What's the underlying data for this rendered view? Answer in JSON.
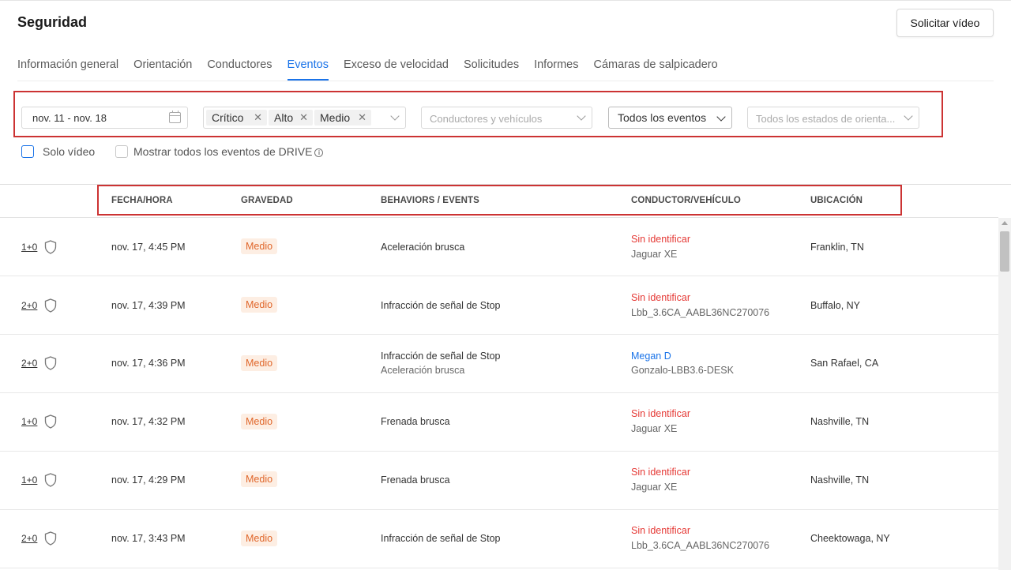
{
  "page": {
    "title": "Seguridad",
    "request_button": "Solicitar vídeo"
  },
  "tabs": [
    {
      "label": "Información general",
      "active": false
    },
    {
      "label": "Orientación",
      "active": false
    },
    {
      "label": "Conductores",
      "active": false
    },
    {
      "label": "Eventos",
      "active": true
    },
    {
      "label": "Exceso de velocidad",
      "active": false
    },
    {
      "label": "Solicitudes",
      "active": false
    },
    {
      "label": "Informes",
      "active": false
    },
    {
      "label": "Cámaras de salpicadero",
      "active": false
    }
  ],
  "filters": {
    "date_range": "nov. 11 - nov. 18",
    "severity_chips": [
      "Crítico",
      "Alto",
      "Medio"
    ],
    "drivers_placeholder": "Conductores y vehículos",
    "events_value": "Todos los eventos",
    "coaching_placeholder": "Todos los estados de orienta...",
    "video_only_label": "Solo vídeo",
    "show_drive_label": "Mostrar todos los eventos de DRIVE"
  },
  "table": {
    "columns": [
      "FECHA/HORA",
      "GRAVEDAD",
      "BEHAVIORS / EVENTS",
      "CONDUCTOR/VEHÍCULO",
      "UBICACIÓN"
    ],
    "rows": [
      {
        "count": "1+0",
        "datetime": "nov. 17, 4:45 PM",
        "severity": "Medio",
        "behaviors": [
          "Aceleración brusca"
        ],
        "driver": "Sin identificar",
        "driver_status": "unidentified",
        "vehicle": "Jaguar XE",
        "location": "Franklin, TN"
      },
      {
        "count": "2+0",
        "datetime": "nov. 17, 4:39 PM",
        "severity": "Medio",
        "behaviors": [
          "Infracción de señal de Stop"
        ],
        "driver": "Sin identificar",
        "driver_status": "unidentified",
        "vehicle": "Lbb_3.6CA_AABL36NC270076",
        "location": "Buffalo, NY"
      },
      {
        "count": "2+0",
        "datetime": "nov. 17, 4:36 PM",
        "severity": "Medio",
        "behaviors": [
          "Infracción de señal de Stop",
          "Aceleración brusca"
        ],
        "driver": "Megan D",
        "driver_status": "identified",
        "vehicle": "Gonzalo-LBB3.6-DESK",
        "location": "San Rafael, CA"
      },
      {
        "count": "1+0",
        "datetime": "nov. 17, 4:32 PM",
        "severity": "Medio",
        "behaviors": [
          "Frenada brusca"
        ],
        "driver": "Sin identificar",
        "driver_status": "unidentified",
        "vehicle": "Jaguar XE",
        "location": "Nashville, TN"
      },
      {
        "count": "1+0",
        "datetime": "nov. 17, 4:29 PM",
        "severity": "Medio",
        "behaviors": [
          "Frenada brusca"
        ],
        "driver": "Sin identificar",
        "driver_status": "unidentified",
        "vehicle": "Jaguar XE",
        "location": "Nashville, TN"
      },
      {
        "count": "2+0",
        "datetime": "nov. 17, 3:43 PM",
        "severity": "Medio",
        "behaviors": [
          "Infracción de señal de Stop"
        ],
        "driver": "Sin identificar",
        "driver_status": "unidentified",
        "vehicle": "Lbb_3.6CA_AABL36NC270076",
        "location": "Cheektowaga, NY"
      }
    ]
  },
  "colors": {
    "accent": "#1a73e8",
    "unidentified": "#e53935",
    "badge_text": "#e0662a",
    "badge_bg": "#fdeee3",
    "highlight": "#cc3333"
  },
  "icons": {
    "calendar": "calendar-icon",
    "shield": "shield-icon",
    "chevron": "chevron-down-icon",
    "info": "info-icon"
  }
}
